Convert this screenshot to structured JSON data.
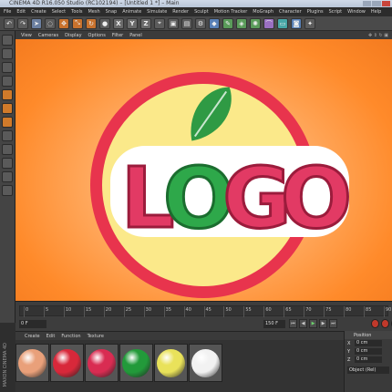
{
  "window": {
    "title": "CINEMA 4D R16.050 Studio (RC102194) – [Untitled 1 *] – Main"
  },
  "menubar": {
    "items": [
      "File",
      "Edit",
      "Create",
      "Select",
      "Tools",
      "Mesh",
      "Snap",
      "Animate",
      "Simulate",
      "Render",
      "Sculpt",
      "Motion Tracker",
      "MoGraph",
      "Character",
      "Plugins",
      "Script",
      "Window",
      "Help"
    ]
  },
  "toolbar": {
    "xyz": [
      "X",
      "Y",
      "Z"
    ]
  },
  "viewport": {
    "menu": [
      "View",
      "Cameras",
      "Display",
      "Options",
      "Filter",
      "Panel"
    ],
    "logo": {
      "letters": [
        "L",
        "O",
        "G",
        "O"
      ],
      "letter_colors": [
        "#e23a64",
        "#2ea84a",
        "#e23a64",
        "#e23a64"
      ],
      "ring_color": "#e8344d",
      "disc_color": "#fbe98a",
      "leaf_color": "#2f9a44",
      "background_color": "#ff9a3c"
    }
  },
  "timeline": {
    "ticks": [
      "0",
      "5",
      "10",
      "15",
      "20",
      "25",
      "30",
      "35",
      "40",
      "45",
      "50",
      "55",
      "60",
      "65",
      "70",
      "75",
      "80",
      "85",
      "90"
    ],
    "current_frame": "0 F",
    "start_frame": "0 F",
    "end_frame": "150 F"
  },
  "material_manager": {
    "menu": [
      "Create",
      "Edit",
      "Function",
      "Texture"
    ],
    "swatches": [
      {
        "color": "#e9a07a"
      },
      {
        "color": "#d8283a"
      },
      {
        "color": "#d92c52"
      },
      {
        "color": "#229a3a"
      },
      {
        "color": "#e9e25a"
      },
      {
        "color": "#f2f2f2"
      }
    ],
    "side_label": "MAXON CINEMA 4D"
  },
  "coordinates": {
    "header": "Position",
    "rows": [
      {
        "axis": "X",
        "value": "0 cm"
      },
      {
        "axis": "Y",
        "value": "0 cm"
      },
      {
        "axis": "Z",
        "value": "0 cm"
      }
    ],
    "mode": "Object (Rel)"
  }
}
